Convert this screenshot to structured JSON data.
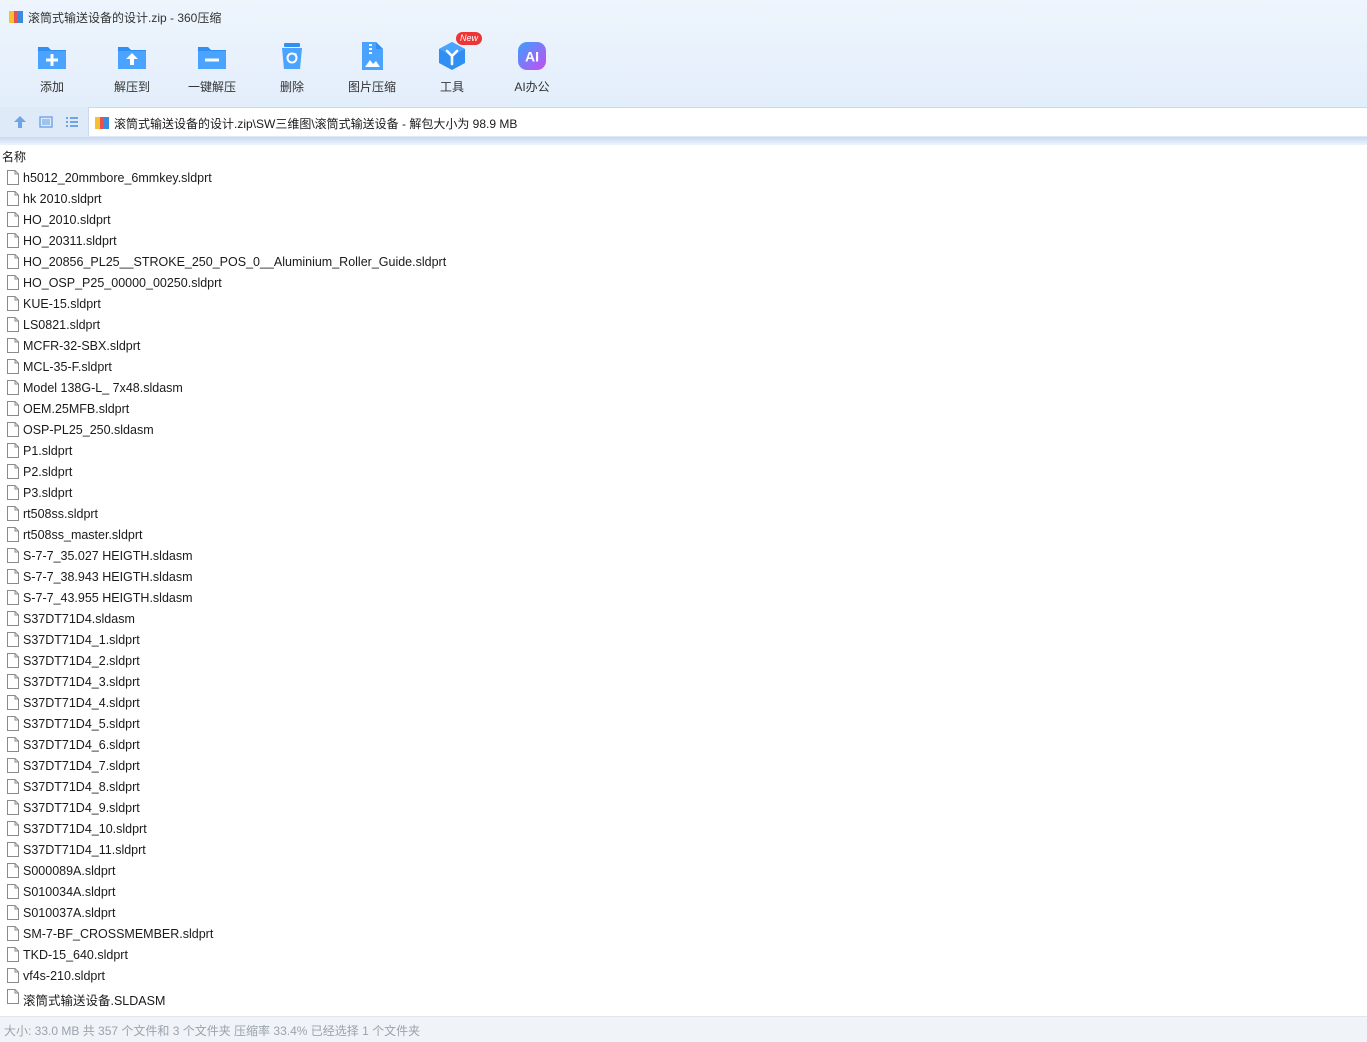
{
  "window": {
    "title": "滚筒式输送设备的设计.zip - 360压缩"
  },
  "toolbar": {
    "buttons": [
      {
        "label": "添加",
        "icon": "add-icon"
      },
      {
        "label": "解压到",
        "icon": "extract-to-icon"
      },
      {
        "label": "一键解压",
        "icon": "one-click-extract-icon"
      },
      {
        "label": "删除",
        "icon": "delete-icon"
      },
      {
        "label": "图片压缩",
        "icon": "image-compress-icon"
      },
      {
        "label": "工具",
        "icon": "tools-icon",
        "badge": "New"
      },
      {
        "label": "AI办公",
        "icon": "ai-office-icon",
        "icon_text": "AI"
      }
    ]
  },
  "address": {
    "path": "滚筒式输送设备的设计.zip\\SW三维图\\滚筒式输送设备 - 解包大小为 98.9 MB"
  },
  "list": {
    "column_name": "名称",
    "files": [
      "h5012_20mmbore_6mmkey.sldprt",
      "hk 2010.sldprt",
      "HO_2010.sldprt",
      "HO_20311.sldprt",
      "HO_20856_PL25__STROKE_250_POS_0__Aluminium_Roller_Guide.sldprt",
      "HO_OSP_P25_00000_00250.sldprt",
      "KUE-15.sldprt",
      "LS0821.sldprt",
      "MCFR-32-SBX.sldprt",
      "MCL-35-F.sldprt",
      "Model 138G-L_ 7x48.sldasm",
      "OEM.25MFB.sldprt",
      "OSP-PL25_250.sldasm",
      "P1.sldprt",
      "P2.sldprt",
      "P3.sldprt",
      "rt508ss.sldprt",
      "rt508ss_master.sldprt",
      "S-7-7_35.027 HEIGTH.sldasm",
      "S-7-7_38.943 HEIGTH.sldasm",
      "S-7-7_43.955 HEIGTH.sldasm",
      "S37DT71D4.sldasm",
      "S37DT71D4_1.sldprt",
      "S37DT71D4_2.sldprt",
      "S37DT71D4_3.sldprt",
      "S37DT71D4_4.sldprt",
      "S37DT71D4_5.sldprt",
      "S37DT71D4_6.sldprt",
      "S37DT71D4_7.sldprt",
      "S37DT71D4_8.sldprt",
      "S37DT71D4_9.sldprt",
      "S37DT71D4_10.sldprt",
      "S37DT71D4_11.sldprt",
      "S000089A.sldprt",
      "S010034A.sldprt",
      "S010037A.sldprt",
      "SM-7-BF_CROSSMEMBER.sldprt",
      "TKD-15_640.sldprt",
      "vf4s-210.sldprt",
      "滚筒式输送设备.SLDASM"
    ]
  },
  "status": {
    "text": "大小: 33.0 MB 共 357 个文件和 3 个文件夹 压缩率 33.4% 已经选择 1 个文件夹"
  },
  "colors": {
    "toolbar_blue": "#2f8ff2",
    "badge_red": "#ee3434",
    "ai_gradient_start": "#3aa0ff",
    "ai_gradient_end": "#c94cf0"
  }
}
